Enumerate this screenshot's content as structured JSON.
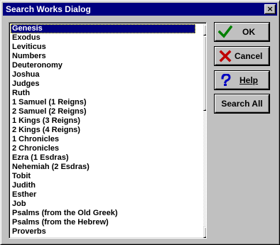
{
  "window": {
    "title": "Search Works Dialog",
    "close_glyph": "×"
  },
  "list": {
    "selected_index": 0,
    "items": [
      "Genesis",
      "Exodus",
      "Leviticus",
      "Numbers",
      "Deuteronomy",
      "Joshua",
      "Judges",
      "Ruth",
      "1 Samuel (1 Reigns)",
      "2 Samuel (2 Reigns)",
      "1 Kings (3 Reigns)",
      "2 Kings (4 Reigns)",
      "1 Chronicles",
      "2 Chronicles",
      "Ezra (1 Esdras)",
      "Nehemiah (2 Esdras)",
      "Tobit",
      "Judith",
      "Esther",
      "Job",
      "Psalms (from the Old Greek)",
      "Psalms (from the Hebrew)",
      "Proverbs"
    ]
  },
  "buttons": {
    "ok_label": "OK",
    "cancel_label": "Cancel",
    "help_label": "Help",
    "search_all_label": "Search All"
  },
  "icons": {
    "ok": "checkmark-icon",
    "cancel": "x-mark-icon",
    "help": "question-mark-icon"
  },
  "colors": {
    "title_bar": "#000080",
    "selection": "#000080",
    "face": "#c0c0c0",
    "ok_icon": "#008000",
    "cancel_icon": "#c00000",
    "help_icon": "#0000c0"
  }
}
